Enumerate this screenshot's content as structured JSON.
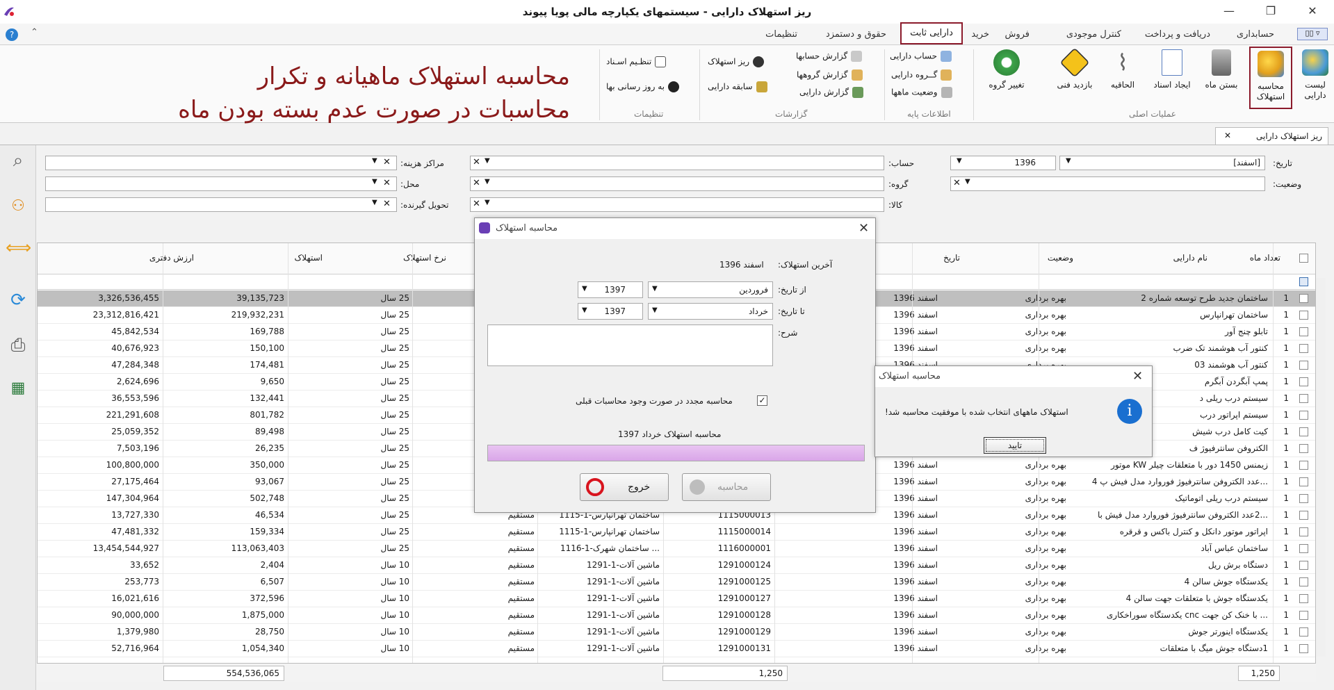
{
  "window": {
    "title": "ریز استهلاک دارایی - سیستمهای یکپارچه مالی پویا پیوند",
    "minimize": "—",
    "restore": "❐",
    "close": "✕"
  },
  "ribbon_tabs": [
    "حسابداری",
    "دریافت و پرداخت",
    "کنترل موجودی",
    "فروش",
    "خرید",
    "دارایی ثابت",
    "حقوق و دستمزد",
    "تنظیمات"
  ],
  "active_tab": "دارایی ثابت",
  "ribbon": {
    "main_ops": {
      "label": "عملیات اصلی",
      "buttons": [
        {
          "label": "لیست دارایی",
          "icon": "asset-list-icon"
        },
        {
          "label": "محاسبه استهلاک",
          "icon": "gears-calc-icon"
        },
        {
          "label": "بستن ماه",
          "icon": "lock-icon"
        },
        {
          "label": "ایجاد اسناد",
          "icon": "create-document-icon"
        },
        {
          "label": "الحاقیه",
          "icon": "paperclip-icon"
        },
        {
          "label": "بازدید فنی",
          "icon": "tools-warning-icon"
        },
        {
          "label": "تغییر گروه",
          "icon": "gear-green-icon"
        }
      ]
    },
    "base_info": {
      "label": "اطلاعات پایه",
      "items": [
        "حساب دارایی",
        "گــروه دارایی",
        "وضعیت ماهها"
      ]
    },
    "reports": {
      "label": "گزارشات",
      "items": [
        "گزارش حسابها",
        "گزارش گروهها",
        "گزارش دارایی",
        "ریز استهلاک",
        "سابقه دارایی"
      ]
    },
    "settings": {
      "label": "تنظیمات",
      "items": [
        "تنظـیم اسـناد",
        "به روز رسانی بها"
      ]
    }
  },
  "overlay_note": {
    "line1": "محاسبه استهلاک ماهیانه و تکرار",
    "line2": "محاسبات  در صورت عدم بسته بودن ماه"
  },
  "document_tab": "ریز استهلاک دارایی",
  "filters": {
    "date_label": "تاریخ:",
    "date_month": "[اسفند]",
    "date_year": "1396",
    "status_label": "وضعیت:",
    "account_label": "حساب:",
    "group_label": "گروه:",
    "item_label": "کالا:",
    "cost_center_label": "مراکز هزینه:",
    "location_label": "محل:",
    "receiver_label": "تحویل گیرنده:"
  },
  "grid": {
    "headers": {
      "months": "تعداد ماه",
      "name": "نام دارایی",
      "status": "وضعیت",
      "date": "تاریخ",
      "rate": "نرخ استهلاک",
      "depreciation": "استهلاک",
      "book_value": "ارزش دفتری"
    },
    "rows": [
      {
        "m": "1",
        "name": "ساختمان جدید طرح توسعه شماره 2",
        "status": "بهره برداری",
        "date": "اسفند 1396",
        "code": "",
        "account": "",
        "method": "",
        "rate": "25 سال",
        "dep": "39,135,723",
        "book": "3,326,536,455",
        "sel": true
      },
      {
        "m": "1",
        "name": "ساختمان تهرانپارس",
        "status": "بهره برداری",
        "date": "اسفند 1396",
        "code": "",
        "account": "",
        "method": "",
        "rate": "25 سال",
        "dep": "219,932,231",
        "book": "23,312,816,421"
      },
      {
        "m": "1",
        "name": "تابلو چنج آور",
        "status": "بهره برداری",
        "date": "اسفند 1396",
        "code": "",
        "account": "",
        "method": "",
        "rate": "25 سال",
        "dep": "169,788",
        "book": "45,842,534"
      },
      {
        "m": "1",
        "name": "کنتور آب هوشمند تک ضرب",
        "status": "بهره برداری",
        "date": "اسفند 1396",
        "code": "",
        "account": "",
        "method": "",
        "rate": "25 سال",
        "dep": "150,100",
        "book": "40,676,923"
      },
      {
        "m": "1",
        "name": "کنتور آب هوشمند 03",
        "status": "بهره برداری",
        "date": "اسفند 1396",
        "code": "",
        "account": "",
        "method": "",
        "rate": "25 سال",
        "dep": "174,481",
        "book": "47,284,348"
      },
      {
        "m": "1",
        "name": "پمپ آبگردن آبگرم",
        "status": "بهره برداری",
        "date": "اسفند 1396",
        "code": "",
        "account": "",
        "method": "",
        "rate": "25 سال",
        "dep": "9,650",
        "book": "2,624,696"
      },
      {
        "m": "1",
        "name": "سیستم درب ریلی د",
        "status": "بهره برداری",
        "date": "اسفند 1396",
        "code": "",
        "account": "",
        "method": "",
        "rate": "25 سال",
        "dep": "132,441",
        "book": "36,553,596"
      },
      {
        "m": "1",
        "name": "سیستم اپراتور درب",
        "status": "بهره برداری",
        "date": "اسفند 1396",
        "code": "",
        "account": "",
        "method": "",
        "rate": "25 سال",
        "dep": "801,782",
        "book": "221,291,608"
      },
      {
        "m": "1",
        "name": "کیت کامل درب شیش",
        "status": "بهره برداری",
        "date": "اسفند 1396",
        "code": "",
        "account": "",
        "method": "",
        "rate": "25 سال",
        "dep": "89,498",
        "book": "25,059,352"
      },
      {
        "m": "1",
        "name": "الکتروفن سانترفیوژ ف",
        "status": "بهره برداری",
        "date": "اسفند 1396",
        "code": "",
        "account": "",
        "method": "",
        "rate": "25 سال",
        "dep": "26,235",
        "book": "7,503,196"
      },
      {
        "m": "1",
        "name": "زیمنس 1450 دور با متعلقات چیلر KW موتور",
        "status": "بهره برداری",
        "date": "اسفند 1396",
        "code": "",
        "account": "",
        "method": "",
        "rate": "25 سال",
        "dep": "350,000",
        "book": "100,800,000"
      },
      {
        "m": "1",
        "name": "...عدد الکتروفن سانترفیوژ فوروارد مدل فیش پ 4",
        "status": "بهره برداری",
        "date": "اسفند 1396",
        "code": "",
        "account": "",
        "method": "",
        "rate": "25 سال",
        "dep": "93,067",
        "book": "27,175,464"
      },
      {
        "m": "1",
        "name": "سیستم درب ریلی اتوماتیک",
        "status": "بهره برداری",
        "date": "اسفند 1396",
        "code": "",
        "account": "",
        "method": "",
        "rate": "25 سال",
        "dep": "502,748",
        "book": "147,304,964"
      },
      {
        "m": "1",
        "name": "...2عدد الکتروفن سانترفیوژ فوروارد مدل فیش با",
        "status": "بهره برداری",
        "date": "اسفند 1396",
        "code": "1115000013",
        "account": "ساختمان تهرانپارس-1-1115",
        "method": "مستقیم",
        "rate": "25 سال",
        "dep": "46,534",
        "book": "13,727,330"
      },
      {
        "m": "1",
        "name": "اپراتور موتور دانکل و کنترل باکس و قرقره",
        "status": "بهره برداری",
        "date": "اسفند 1396",
        "code": "1115000014",
        "account": "ساختمان تهرانپارس-1-1115",
        "method": "مستقیم",
        "rate": "25 سال",
        "dep": "159,334",
        "book": "47,481,332"
      },
      {
        "m": "1",
        "name": "ساختمان عباس آباد",
        "status": "بهره برداری",
        "date": "اسفند 1396",
        "code": "1116000001",
        "account": "... ساختمان شهرک-1-1116",
        "method": "مستقیم",
        "rate": "25 سال",
        "dep": "113,063,403",
        "book": "13,454,544,927"
      },
      {
        "m": "1",
        "name": "دستگاه برش ریل",
        "status": "بهره برداری",
        "date": "اسفند 1396",
        "code": "1291000124",
        "account": "ماشین آلات-1-1291",
        "method": "مستقیم",
        "rate": "10 سال",
        "dep": "2,404",
        "book": "33,652"
      },
      {
        "m": "1",
        "name": "یکدستگاه جوش سالن 4",
        "status": "بهره برداری",
        "date": "اسفند 1396",
        "code": "1291000125",
        "account": "ماشین آلات-1-1291",
        "method": "مستقیم",
        "rate": "10 سال",
        "dep": "6,507",
        "book": "253,773"
      },
      {
        "m": "1",
        "name": "یکدستگاه جوش با متعلقات جهت سالن 4",
        "status": "بهره برداری",
        "date": "اسفند 1396",
        "code": "1291000127",
        "account": "ماشین آلات-1-1291",
        "method": "مستقیم",
        "rate": "10 سال",
        "dep": "372,596",
        "book": "16,021,616"
      },
      {
        "m": "1",
        "name": "... با خنک کن جهت cnc یکدستگاه سوراخکاری",
        "status": "بهره برداری",
        "date": "اسفند 1396",
        "code": "1291000128",
        "account": "ماشین آلات-1-1291",
        "method": "مستقیم",
        "rate": "10 سال",
        "dep": "1,875,000",
        "book": "90,000,000"
      },
      {
        "m": "1",
        "name": "یکدستگاه اینورتر جوش",
        "status": "بهره برداری",
        "date": "اسفند 1396",
        "code": "1291000129",
        "account": "ماشین آلات-1-1291",
        "method": "مستقیم",
        "rate": "10 سال",
        "dep": "28,750",
        "book": "1,379,980"
      },
      {
        "m": "1",
        "name": "1دستگاه جوش میگ با متعلقات",
        "status": "بهره برداری",
        "date": "اسفند 1396",
        "code": "1291000131",
        "account": "ماشین آلات-1-1291",
        "method": "مستقیم",
        "rate": "10 سال",
        "dep": "1,054,340",
        "book": "52,716,964"
      }
    ],
    "footer": {
      "months_total": "1,250",
      "mid_total": "1,250",
      "dep_total": "554,536,065"
    }
  },
  "dialog_calc": {
    "title": "محاسبه استهلاک",
    "last_dep_label": "آخرین استهلاک:",
    "last_dep_value": "اسفند 1396",
    "from_label": "از تاریخ:",
    "from_month": "فروردین",
    "from_year": "1397",
    "to_label": "تا تاریخ:",
    "to_month": "خرداد",
    "to_year": "1397",
    "desc_label": "شرح:",
    "recalc_label": "محاسبه مجدد در صورت وجود محاسبات قبلی",
    "recalc_checked": true,
    "progress_text": "محاسبه استهلاک خرداد 1397",
    "progress": 1.0,
    "calc_button": "محاسبه",
    "exit_button": "خروج"
  },
  "dialog_msg": {
    "title": "محاسبه استهلاک",
    "message": "استهلاک ماههای انتخاب شده با موفقیت محاسبه شد!",
    "ok_button": "تایید"
  }
}
